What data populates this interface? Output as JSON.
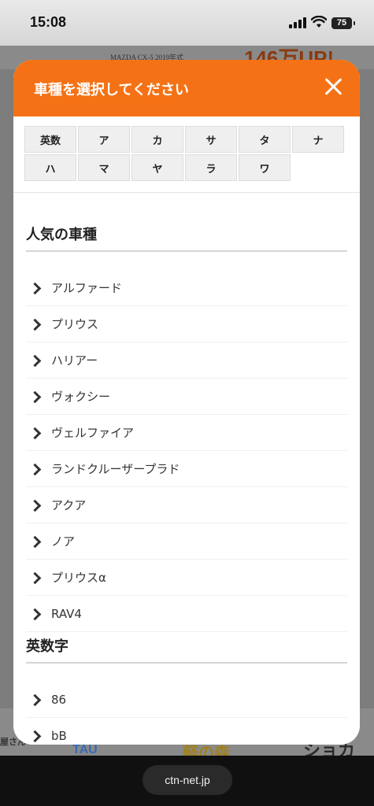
{
  "status_bar": {
    "time": "15:08",
    "battery": "75"
  },
  "background": {
    "caption": "MAZDA CX-5 2019年式",
    "promo": "146万UP!",
    "bottom_texts": [
      "屋さん",
      "TAU",
      "軽の森",
      "ショカ"
    ]
  },
  "modal": {
    "title": "車種を選択してください",
    "kana_tabs": [
      "英数",
      "ア",
      "カ",
      "サ",
      "タ",
      "ナ",
      "ハ",
      "マ",
      "ヤ",
      "ラ",
      "ワ"
    ],
    "sections": [
      {
        "heading": "人気の車種",
        "items": [
          "アルファード",
          "プリウス",
          "ハリアー",
          "ヴォクシー",
          "ヴェルファイア",
          "ランドクルーザープラド",
          "アクア",
          "ノア",
          "プリウスα",
          "RAV4"
        ]
      },
      {
        "heading": "英数字",
        "items": [
          "86",
          "bB"
        ]
      }
    ]
  },
  "browser": {
    "url": "ctn-net.jp"
  }
}
